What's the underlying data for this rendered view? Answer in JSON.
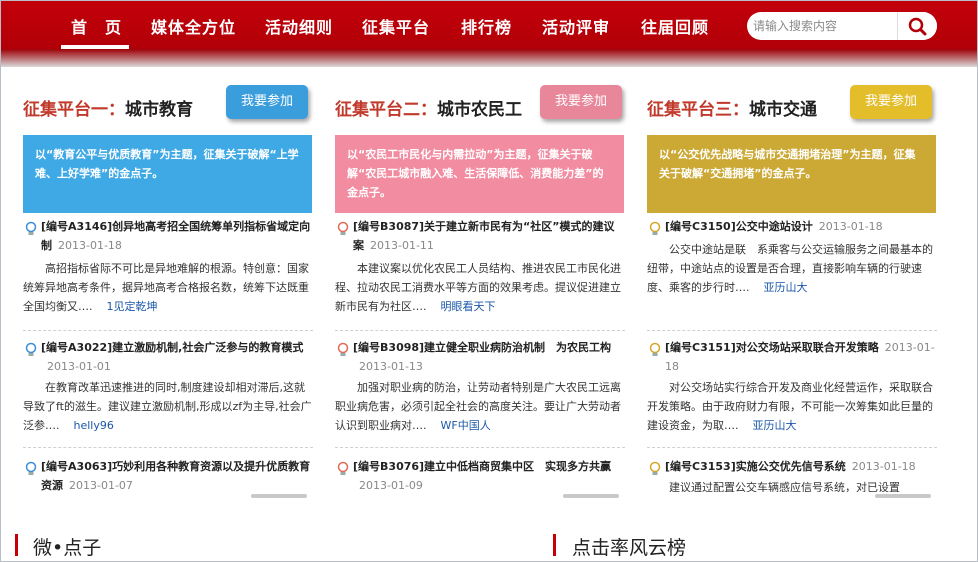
{
  "nav": {
    "items": [
      "首　页",
      "媒体全方位",
      "活动细则",
      "征集平台",
      "排行榜",
      "活动评审",
      "往届回顾"
    ],
    "search_placeholder": "请输入搜索内容"
  },
  "columns": [
    {
      "title_prefix": "征集平台一：",
      "title_main": "城市教育",
      "join_label": "我要参加",
      "accent": "#c0392b",
      "banner_color": "#3fa9e6",
      "button_color": "#3a9edc",
      "banner_text": "以“教育公平与优质教育”为主题，征集关于破解“上学难、上好学难”的金点子。",
      "items": [
        {
          "title": "[编号A3146]创异地高考招全国统筹单列指标省域定向制",
          "date": "2013-01-18",
          "body": "高招指标省际不可比是异地难解的根源。特创意：国家统筹异地高考条件，据异地高考合格报名数，统筹下达既重全国均衡又….",
          "author": "1见定乾坤"
        },
        {
          "title": "[编号A3022]建立激励机制,社会广泛参与的教育模式",
          "date": "2013-01-01",
          "body": "在教育改革迅速推进的同时,制度建设却相对滞后,这就导致了ft的滋生。建议建立激励机制,形成以zf为主导,社会广泛参….",
          "author": "helly96"
        },
        {
          "title": "[编号A3063]巧妙利用各种教育资源以及提升优质教育资源",
          "date": "2013-01-07",
          "body": "",
          "author": ""
        }
      ]
    },
    {
      "title_prefix": "征集平台二：",
      "title_main": "城市农民工",
      "join_label": "我要参加",
      "accent": "#c0392b",
      "banner_color": "#f28ca0",
      "button_color": "#e8869a",
      "banner_text": "以“农民工市民化与内需拉动”为主题，征集关于破解“农民工城市融入难、生活保障低、消费能力差”的金点子。",
      "items": [
        {
          "title": "[编号B3087]关于建立新市民有为“社区”模式的建议案",
          "date": "2013-01-11",
          "body": "本建议案以优化农民工人员结构、推进农民工市民化进程、拉动农民工消费水平等方面的效果考虑。提议促进建立新市民有为社区….",
          "author": "明眼看天下"
        },
        {
          "title": "[编号B3098]建立健全职业病防治机制　为农民工构",
          "date": "2013-01-13",
          "body": "加强对职业病的防治，让劳动者特别是广大农民工远离职业病危害，必须引起全社会的高度关注。要让广大劳动者认识到职业病对….",
          "author": "WF中国人"
        },
        {
          "title": "[编号B3076]建立中低档商贸集中区　实现多方共赢",
          "date": "2013-01-09",
          "body": "",
          "author": ""
        }
      ]
    },
    {
      "title_prefix": "征集平台三：",
      "title_main": "城市交通",
      "join_label": "我要参加",
      "accent": "#c0392b",
      "banner_color": "#cca935",
      "button_color": "#e3bd2a",
      "banner_text": "以“公交优先战略与城市交通拥堵治理”为主题，征集关于破解“交通拥堵”的金点子。",
      "items": [
        {
          "title": "[编号C3150]公交中途站设计",
          "date": "2013-01-18",
          "body": "公交中途站是联　系乘客与公交运输服务之间最基本的纽带，中途站点的设置是否合理，直接影响车辆的行驶速度、乘客的步行时….",
          "author": "亚历山大"
        },
        {
          "title": "[编号C3151]对公交场站采取联合开发策略",
          "date": "2013-01-18",
          "body": "对公交场站实行综合开发及商业化经营运作，采取联合开发策略。由于政府财力有限，不可能一次筹集如此巨量的建设资金，为取….",
          "author": "亚历山大"
        },
        {
          "title": "[编号C3153]实施公交优先信号系统",
          "date": "2013-01-18",
          "body": "建议通过配置公交车辆感应信号系统，对已设置",
          "author": ""
        }
      ]
    }
  ],
  "footer": {
    "left_title": "微•点子",
    "right_title": "点击率风云榜",
    "bar_color": "#c40008"
  }
}
